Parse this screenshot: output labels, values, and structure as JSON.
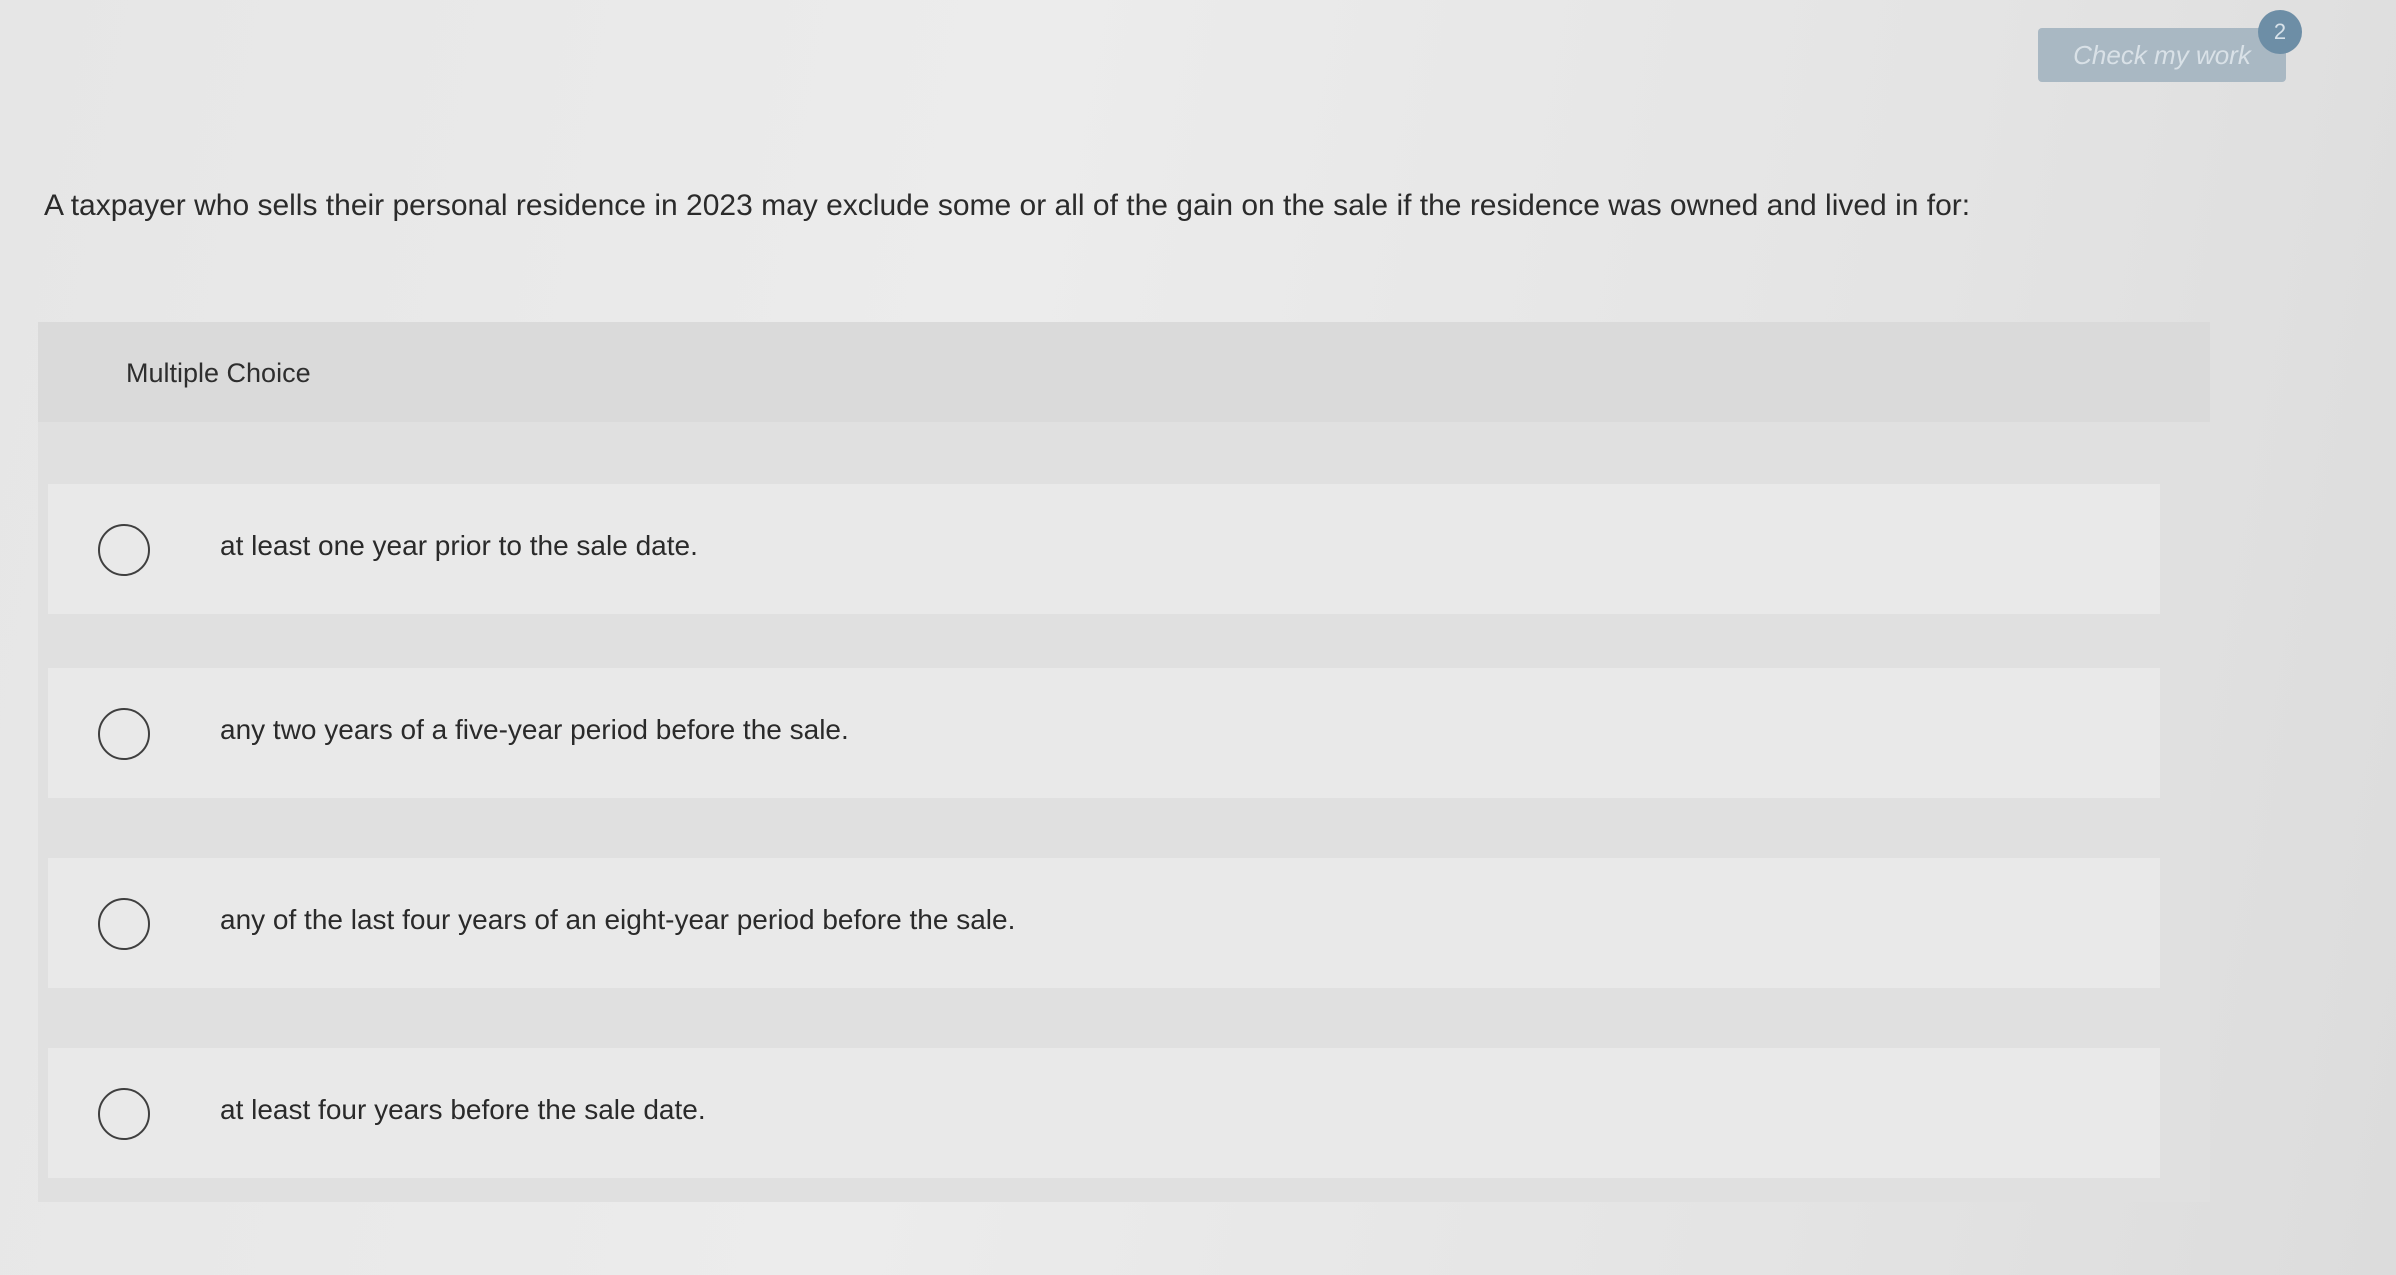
{
  "header": {
    "check_button_label": "Check my work",
    "badge_count": "2"
  },
  "question": {
    "text": "A taxpayer who sells their personal residence in 2023 may exclude some or all of the gain on the sale if the residence was owned and lived in for:"
  },
  "choices": {
    "header_label": "Multiple Choice",
    "options": [
      {
        "label": "at least one year prior to the sale date."
      },
      {
        "label": "any two years of a five-year period before the sale."
      },
      {
        "label": "any of the last four years of an eight-year period before the sale."
      },
      {
        "label": "at least four years before the sale date."
      }
    ]
  },
  "colors": {
    "button_bg": "#a9b8c3",
    "badge_bg": "#6d8ea6",
    "panel_bg": "#e0e0e0"
  }
}
